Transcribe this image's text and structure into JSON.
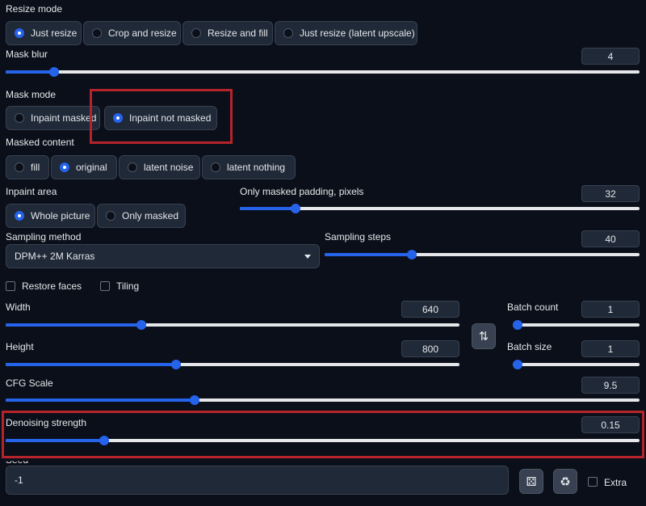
{
  "resize_mode": {
    "label": "Resize mode",
    "options": [
      "Just resize",
      "Crop and resize",
      "Resize and fill",
      "Just resize (latent upscale)"
    ],
    "selected": "Just resize"
  },
  "mask_blur": {
    "label": "Mask blur",
    "value": "4",
    "fraction": 0.07
  },
  "mask_mode": {
    "label": "Mask mode",
    "options": [
      "Inpaint masked",
      "Inpaint not masked"
    ],
    "selected": "Inpaint not masked"
  },
  "masked_content": {
    "label": "Masked content",
    "options": [
      "fill",
      "original",
      "latent noise",
      "latent nothing"
    ],
    "selected": "original"
  },
  "inpaint_area": {
    "label": "Inpaint area",
    "options": [
      "Whole picture",
      "Only masked"
    ],
    "selected": "Whole picture"
  },
  "only_masked_padding": {
    "label": "Only masked padding, pixels",
    "value": "32",
    "fraction": 0.13
  },
  "sampling_method": {
    "label": "Sampling method",
    "value": "DPM++ 2M Karras"
  },
  "sampling_steps": {
    "label": "Sampling steps",
    "value": "40",
    "fraction": 0.27
  },
  "restore_faces": {
    "label": "Restore faces",
    "checked": false
  },
  "tiling": {
    "label": "Tiling",
    "checked": false
  },
  "width": {
    "label": "Width",
    "value": "640",
    "fraction": 0.295
  },
  "height": {
    "label": "Height",
    "value": "800",
    "fraction": 0.373
  },
  "swap_icon": "swap-arrows-icon",
  "batch_count": {
    "label": "Batch count",
    "value": "1",
    "fraction": 0.0
  },
  "batch_size": {
    "label": "Batch size",
    "value": "1",
    "fraction": 0.0
  },
  "cfg_scale": {
    "label": "CFG Scale",
    "value": "9.5",
    "fraction": 0.295
  },
  "denoising_strength": {
    "label": "Denoising strength",
    "value": "0.15",
    "fraction": 0.15
  },
  "seed": {
    "label": "Seed",
    "value": "-1"
  },
  "extra": {
    "label": "Extra",
    "checked": false
  },
  "icons": {
    "random": "dice-icon",
    "reuse": "recycle-icon",
    "dropdown": "chevron-down-icon"
  },
  "colors": {
    "accent": "#2563eb",
    "highlight": "#b5232b",
    "background": "#0b0f19"
  }
}
